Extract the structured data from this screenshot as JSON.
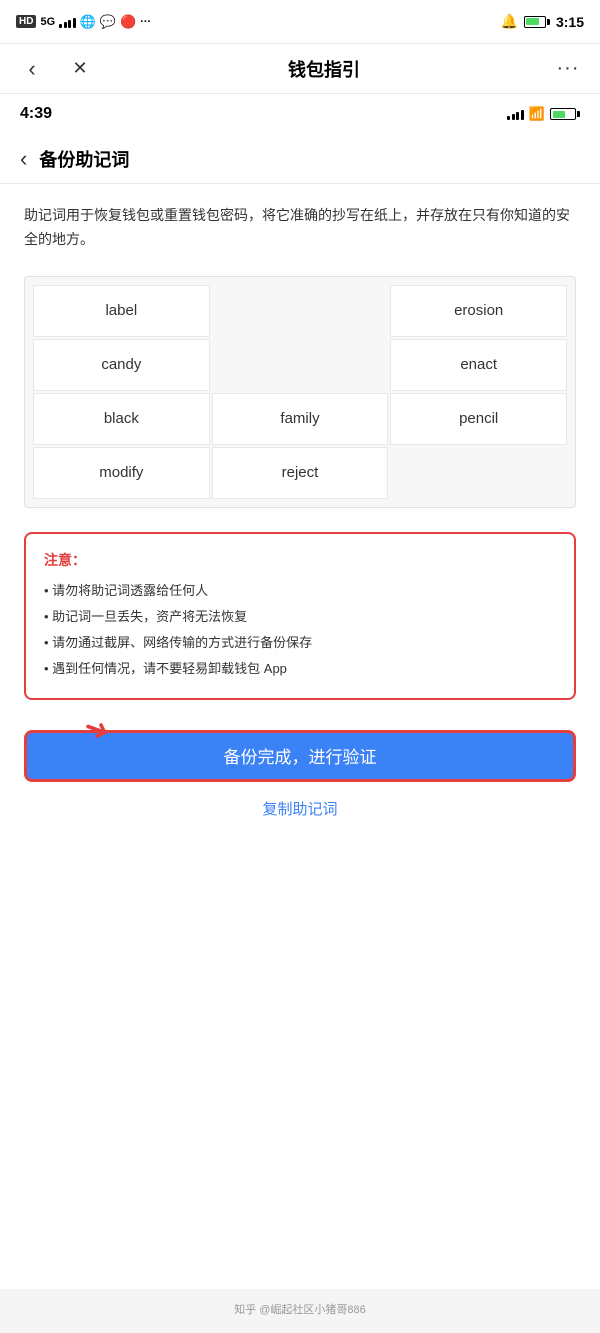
{
  "outer_status": {
    "signal": "5G",
    "time": "3:15",
    "icons_left": [
      "HD",
      "5G",
      "signal-bars",
      "weibo",
      "qq",
      "red-dot",
      "more"
    ]
  },
  "outer_nav": {
    "back_label": "‹",
    "close_label": "✕",
    "title": "钱包指引",
    "more_label": "···"
  },
  "inner_status": {
    "time": "4:39"
  },
  "inner_nav": {
    "back_label": "‹",
    "title": "备份助记词"
  },
  "content": {
    "description": "助记词用于恢复钱包或重置钱包密码，将它准确的抄写在纸上，并存放在只有你知道的安全的地方。",
    "mnemonic_words": [
      "label",
      "",
      "erosion",
      "candy",
      "",
      "enact",
      "black",
      "family",
      "pencil",
      "modify",
      "reject",
      ""
    ],
    "warning_title": "注意：",
    "warning_items": [
      "• 请勿将助记词透露给任何人",
      "• 助记词一旦丢失，资产将无法恢复",
      "• 请勿通过截屏、网络传输的方式进行备份保存",
      "• 遇到任何情况，请不要轻易卸载钱包 App"
    ],
    "confirm_button": "备份完成，进行验证",
    "copy_link": "复制助记词"
  },
  "watermark": "知乎 @崛起社区小猪哥886"
}
